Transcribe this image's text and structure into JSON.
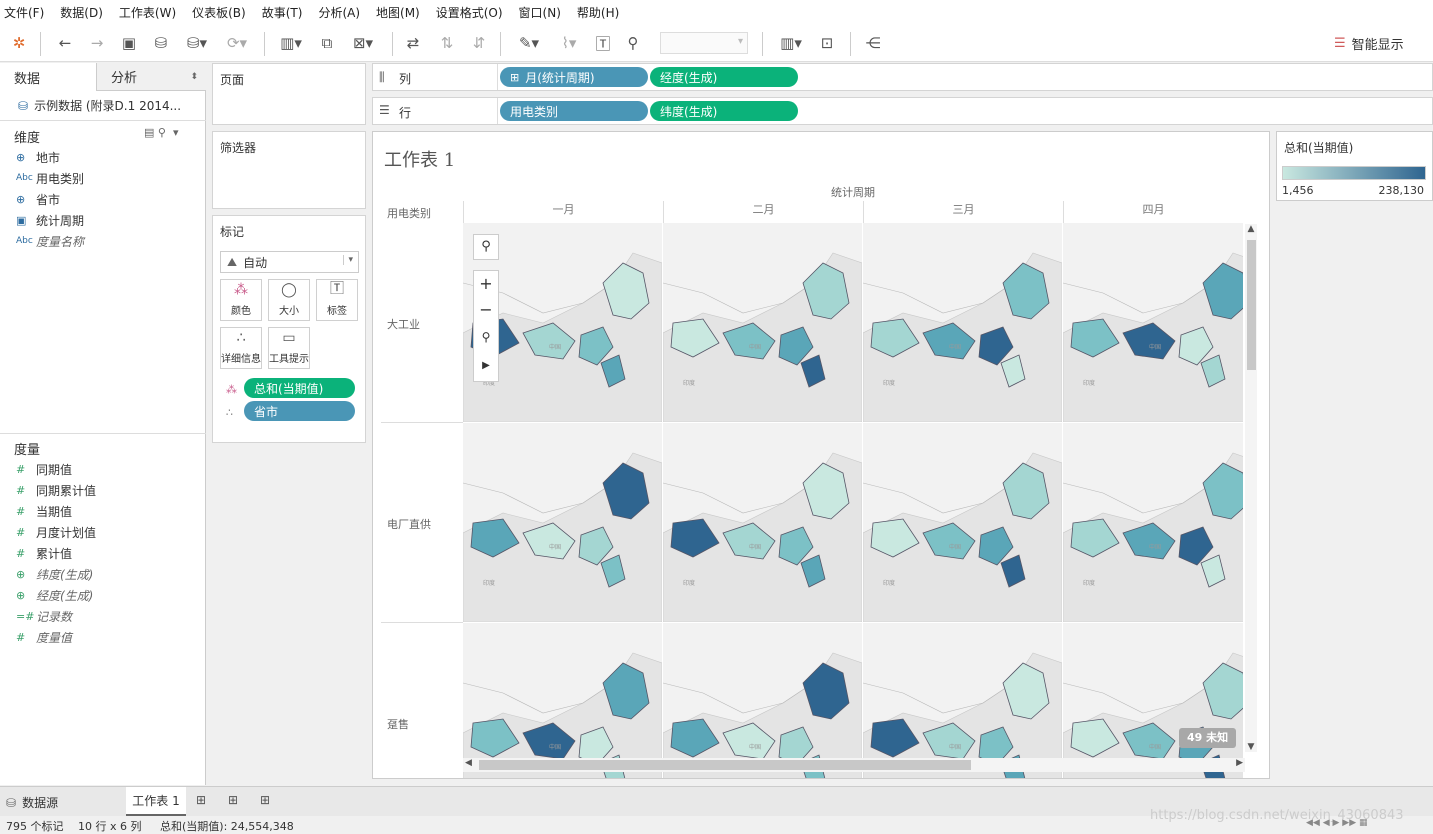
{
  "menu": [
    "文件(F)",
    "数据(D)",
    "工作表(W)",
    "仪表板(B)",
    "故事(T)",
    "分析(A)",
    "地图(M)",
    "设置格式(O)",
    "窗口(N)",
    "帮助(H)"
  ],
  "toolbar": {
    "show_me_label": "智能显示"
  },
  "left_panel": {
    "tabs": [
      "数据",
      "分析"
    ],
    "datasource": "示例数据 (附录D.1 2014...",
    "dimensions_title": "维度",
    "dimensions": [
      {
        "icon": "globe-icon",
        "label": "地市",
        "italic": false
      },
      {
        "icon": "abc-icon",
        "label": "用电类别",
        "italic": false
      },
      {
        "icon": "globe-icon",
        "label": "省市",
        "italic": false
      },
      {
        "icon": "calendar-icon",
        "label": "统计周期",
        "italic": false
      },
      {
        "icon": "abc-icon",
        "label": "度量名称",
        "italic": true
      }
    ],
    "measures_title": "度量",
    "measures": [
      {
        "icon": "hash-icon",
        "label": "同期值",
        "italic": false
      },
      {
        "icon": "hash-icon",
        "label": "同期累计值",
        "italic": false
      },
      {
        "icon": "hash-icon",
        "label": "当期值",
        "italic": false
      },
      {
        "icon": "hash-icon",
        "label": "月度计划值",
        "italic": false
      },
      {
        "icon": "hash-icon",
        "label": "累计值",
        "italic": false
      },
      {
        "icon": "globe-icon",
        "label": "纬度(生成)",
        "italic": true
      },
      {
        "icon": "globe-icon",
        "label": "经度(生成)",
        "italic": true
      },
      {
        "icon": "hash-icon",
        "label": "记录数",
        "italic": true
      },
      {
        "icon": "hash-icon",
        "label": "度量值",
        "italic": true
      }
    ]
  },
  "cards": {
    "pages": "页面",
    "filters": "筛选器",
    "marks": "标记",
    "mark_type": "自动",
    "mark_buttons": [
      "颜色",
      "大小",
      "标签",
      "详细信息",
      "工具提示"
    ],
    "mark_pills": [
      "总和(当期值)",
      "省市"
    ]
  },
  "shelves": {
    "columns_label": "列",
    "rows_label": "行",
    "columns": [
      "月(统计周期)",
      "经度(生成)"
    ],
    "rows": [
      "用电类别",
      "纬度(生成)"
    ]
  },
  "sheet": {
    "title": "工作表 1",
    "top_header": "统计周期",
    "row_header_title": "用电类别",
    "months": [
      "一月",
      "二月",
      "三月",
      "四月"
    ],
    "rows": [
      "大工业",
      "电厂直供",
      "趸售"
    ],
    "map_label": "印度",
    "map_label2": "中国",
    "unknown_badge": "49 未知"
  },
  "legend": {
    "title": "总和(当期值)",
    "min": "1,456",
    "max": "238,130",
    "color_low": "#c9e8e0",
    "color_high": "#2f6590"
  },
  "bottom_tabs": {
    "datasource": "数据源",
    "sheet": "工作表 1"
  },
  "status": {
    "marks": "795 个标记",
    "dims": "10 行 x 6 列",
    "sum": "总和(当期值): 24,554,348",
    "watermark": "https://blog.csdn.net/weixin_43060843"
  }
}
